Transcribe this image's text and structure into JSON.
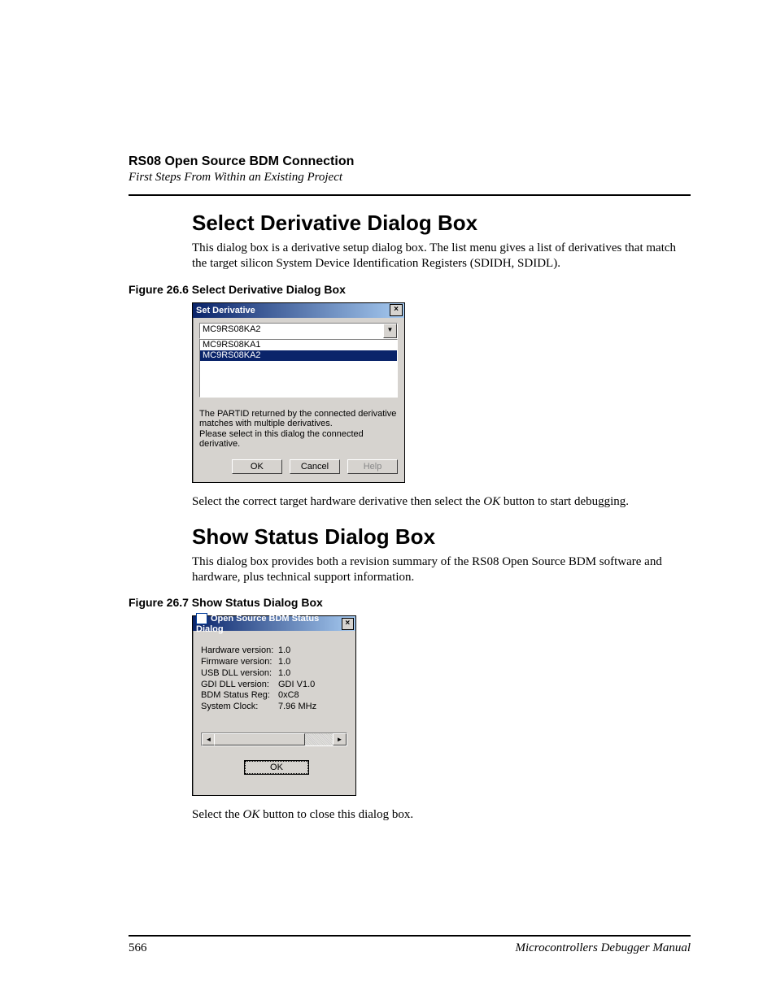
{
  "header": {
    "chapter": "RS08 Open Source BDM Connection",
    "section": "First Steps From Within an Existing Project"
  },
  "sec1": {
    "title": "Select Derivative Dialog Box",
    "para": "This dialog box is a derivative setup dialog box. The list menu gives a list of derivatives that match the target silicon System Device Identification Registers (SDIDH, SDIDL).",
    "caption": "Figure 26.6  Select Derivative Dialog Box",
    "after_pre": "Select the correct target hardware derivative then select the ",
    "after_em": "OK",
    "after_post": " button to start debugging."
  },
  "dlg1": {
    "title": "Set Derivative",
    "close": "×",
    "selected": "MC9RS08KA2",
    "arrow": "▼",
    "options": [
      "MC9RS08KA1",
      "MC9RS08KA2"
    ],
    "msg1": "The PARTID returned by the connected derivative matches with multiple derivatives.",
    "msg2": "Please select in this dialog the connected derivative.",
    "ok": "OK",
    "cancel": "Cancel",
    "help": "Help"
  },
  "sec2": {
    "title": "Show Status Dialog Box",
    "para": "This dialog box provides both a revision summary of the RS08 Open Source BDM software and hardware, plus technical support information.",
    "caption": "Figure 26.7  Show Status Dialog Box",
    "after_pre": "Select the ",
    "after_em": "OK",
    "after_post": " button to close this dialog box."
  },
  "dlg2": {
    "title": "Open Source BDM Status Dialog",
    "close": "×",
    "rows": [
      {
        "label": "Hardware version:",
        "value": "1.0"
      },
      {
        "label": "Firmware version:",
        "value": "1.0"
      },
      {
        "label": "USB DLL version:",
        "value": "1.0"
      },
      {
        "label": "GDI DLL version:",
        "value": "GDI V1.0"
      },
      {
        "label": "BDM Status Reg:",
        "value": "0xC8"
      },
      {
        "label": "System Clock:",
        "value": "7.96 MHz"
      }
    ],
    "left": "◄",
    "right": "►",
    "ok": "OK"
  },
  "footer": {
    "page": "566",
    "manual": "Microcontrollers Debugger Manual"
  }
}
